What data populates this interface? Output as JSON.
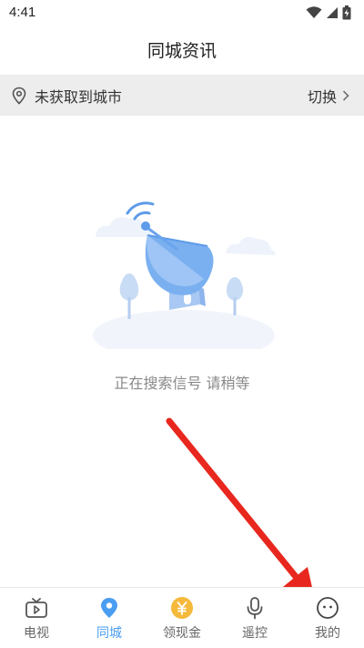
{
  "status_bar": {
    "time": "4:41"
  },
  "header": {
    "title": "同城资讯"
  },
  "location": {
    "text": "未获取到城市",
    "switch_label": "切换"
  },
  "main": {
    "status_text": "正在搜索信号 请稍等"
  },
  "tabs": [
    {
      "label": "电视",
      "icon": "tv-icon",
      "active": false
    },
    {
      "label": "同城",
      "icon": "location-pin-icon",
      "active": true
    },
    {
      "label": "领现金",
      "icon": "yen-coin-icon",
      "active": false
    },
    {
      "label": "遥控",
      "icon": "microphone-icon",
      "active": false
    },
    {
      "label": "我的",
      "icon": "smiley-face-icon",
      "active": false
    }
  ],
  "colors": {
    "accent": "#4a9df0",
    "coin": "#f5b93b",
    "arrow": "#e8271e",
    "location_bar_bg": "#ededed"
  }
}
